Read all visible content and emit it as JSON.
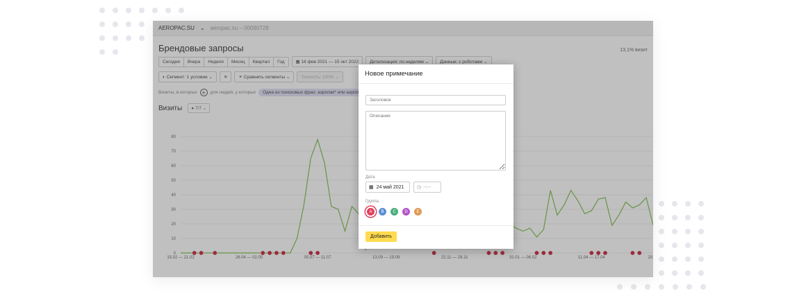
{
  "header": {
    "site": "AEROPAC.SU",
    "subtitle": "aeropac.su – 00090728"
  },
  "page": {
    "title": "Брендовые запросы",
    "share": "13,1% визит"
  },
  "period_buttons": [
    "Сегодня",
    "Вчера",
    "Неделя",
    "Месяц",
    "Квартал",
    "Год"
  ],
  "date_range": "16 фев 2021 — 15 окт 2022",
  "detail": "Детализация: по неделям",
  "data_mode": "Данные: с роботами",
  "segment": "Сегмент: 1 условие",
  "compare": "Сравнить сегменты",
  "accuracy": "Точность: 100%",
  "filter": {
    "prefix": "Визиты, в которых",
    "people": "для людей, у которых",
    "chip": "Одна из поисковых фраз: аэропак* или аэропак"
  },
  "chart_header": {
    "title": "Визиты",
    "selector": "7/7"
  },
  "modal": {
    "title": "Новое примечание",
    "title_placeholder": "Заголовок",
    "desc_placeholder": "Описание",
    "date_label": "Дата",
    "date_value": "24 май 2021",
    "time_placeholder": "--:--",
    "group_label": "Группа",
    "groups": [
      {
        "letter": "A",
        "color": "#e2405f"
      },
      {
        "letter": "B",
        "color": "#5a8fd6"
      },
      {
        "letter": "C",
        "color": "#4cae7e"
      },
      {
        "letter": "D",
        "color": "#b455c9"
      },
      {
        "letter": "E",
        "color": "#e09a55"
      }
    ],
    "add_label": "Добавить"
  },
  "chart_data": {
    "type": "line",
    "ylim": [
      0,
      80
    ],
    "yticks": [
      0,
      10,
      20,
      30,
      40,
      50,
      60,
      70,
      80
    ],
    "xtick_labels": [
      "15.02 — 21.02",
      "26.04 — 02.05",
      "05.07 — 11.07",
      "13.09 — 19.09",
      "22.11 — 28.11",
      "31.01 — 06.02",
      "11.04 — 17.04",
      "20.06"
    ],
    "xtick_weeks": [
      0,
      10,
      20,
      30,
      40,
      50,
      60,
      69
    ],
    "series": [
      {
        "color": "#6fb83a",
        "values": [
          0,
          0,
          0,
          0,
          0,
          0,
          0,
          0,
          0,
          0,
          0,
          0,
          0,
          0,
          0,
          0,
          0,
          10,
          33,
          65,
          78,
          62,
          32,
          30,
          15,
          32,
          27,
          2,
          20,
          22,
          22,
          20,
          22,
          22,
          22,
          20,
          22,
          20,
          22,
          22,
          22,
          22,
          22,
          22,
          22,
          22,
          22,
          20,
          20,
          17,
          15,
          17,
          11,
          16,
          43,
          26,
          33,
          43,
          36,
          27,
          29,
          37,
          38,
          19,
          26,
          35,
          31,
          33,
          38,
          19
        ]
      }
    ],
    "annotations_weeks": [
      2,
      3,
      5,
      12,
      13,
      14,
      15,
      19,
      20,
      37,
      45,
      46,
      47,
      52,
      53,
      54,
      60,
      61,
      62,
      66,
      67
    ]
  }
}
